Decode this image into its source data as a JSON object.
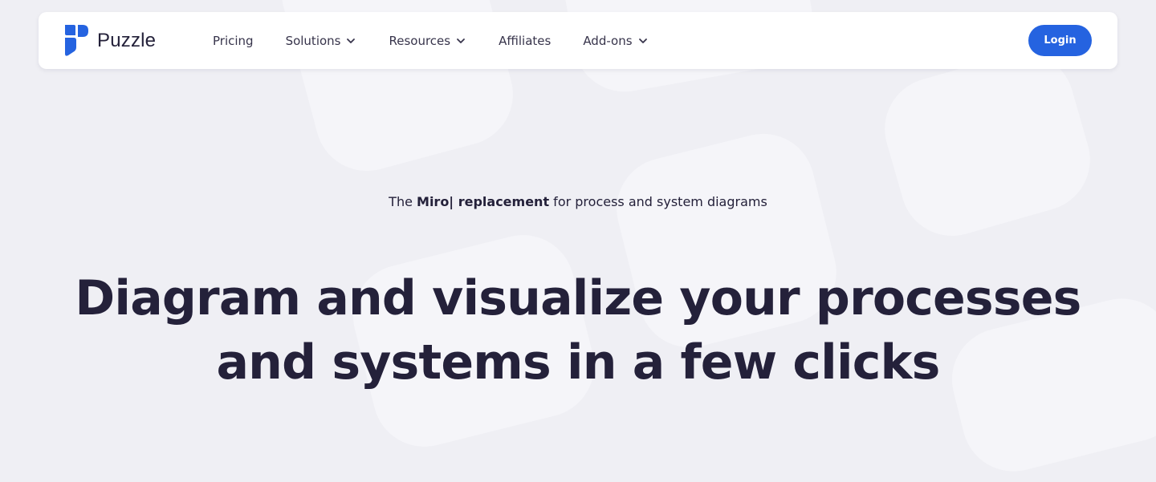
{
  "brand": {
    "name": "Puzzle",
    "color": "#2563e0"
  },
  "nav": {
    "items": [
      {
        "label": "Pricing",
        "dropdown": false
      },
      {
        "label": "Solutions",
        "dropdown": true
      },
      {
        "label": "Resources",
        "dropdown": true
      },
      {
        "label": "Affiliates",
        "dropdown": false
      },
      {
        "label": "Add-ons",
        "dropdown": true
      }
    ],
    "login_label": "Login"
  },
  "hero": {
    "tagline_prefix": "The ",
    "tagline_bold": "Miro| replacement",
    "tagline_suffix": " for process and system diagrams",
    "headline_line1": "Diagram and visualize your processes",
    "headline_line2": "and systems in a few clicks"
  },
  "colors": {
    "accent": "#2563e0",
    "text": "#24213a",
    "background": "#efeff4"
  }
}
